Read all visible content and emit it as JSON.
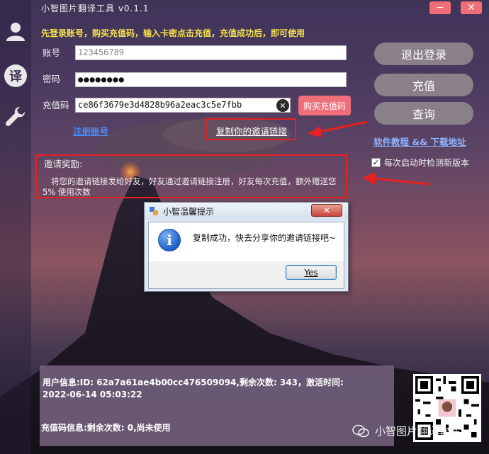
{
  "window": {
    "title": "小智图片翻译工具 v0.1.1",
    "minimize_label": "−",
    "close_label": "✕"
  },
  "sidebar": {
    "items": [
      {
        "icon": "user-icon"
      },
      {
        "icon": "translate-icon",
        "label": "译"
      },
      {
        "icon": "wrench-icon"
      }
    ]
  },
  "notice": "先登录账号，购买充值码，输入卡密点击充值，充值成功后，即可使用",
  "form": {
    "account_label": "账号",
    "account_value": "123456789",
    "password_label": "密码",
    "password_value": "●●●●●●●●",
    "code_label": "充值码",
    "code_value": "ce86f3679e3d4828b96a2eac3c5e7fbb",
    "clear_label": "✕",
    "buy_label": "购买充值码"
  },
  "links": {
    "register": "注册账号",
    "copy_invite": "复制你的邀请链接",
    "tutorial": "软件教程 && 下载地址"
  },
  "invite": {
    "title": "邀请奖励:",
    "body": "将您的邀请链接发给好友，好友通过邀请链接注册，好友每次充值，额外赠送您 5% 使用次数"
  },
  "right_buttons": {
    "logout": "退出登录",
    "recharge": "充值",
    "query": "查询"
  },
  "auto_check": {
    "label": "每次启动时检测新版本",
    "checked": true,
    "mark": "✓"
  },
  "info": {
    "user": "用户信息:ID: 62a7a61ae4b00cc476509094,剩余次数: 343，激活时间: 2022-06-14 05:03:22",
    "code": "充值码信息:剩余次数: 0,尚未使用"
  },
  "dialog": {
    "title": "小智温馨提示",
    "message": "复制成功，快去分享你的邀请链接吧~",
    "close_label": "✕",
    "yes_label": "Yes",
    "icon_glyph": "i"
  },
  "watermark": "小智图片翻译软件",
  "colors": {
    "accent_red": "#e82020",
    "link_blue": "#4d8bf5",
    "notice_yellow": "#f4e04a",
    "button_pink": "#ee6f7a"
  }
}
